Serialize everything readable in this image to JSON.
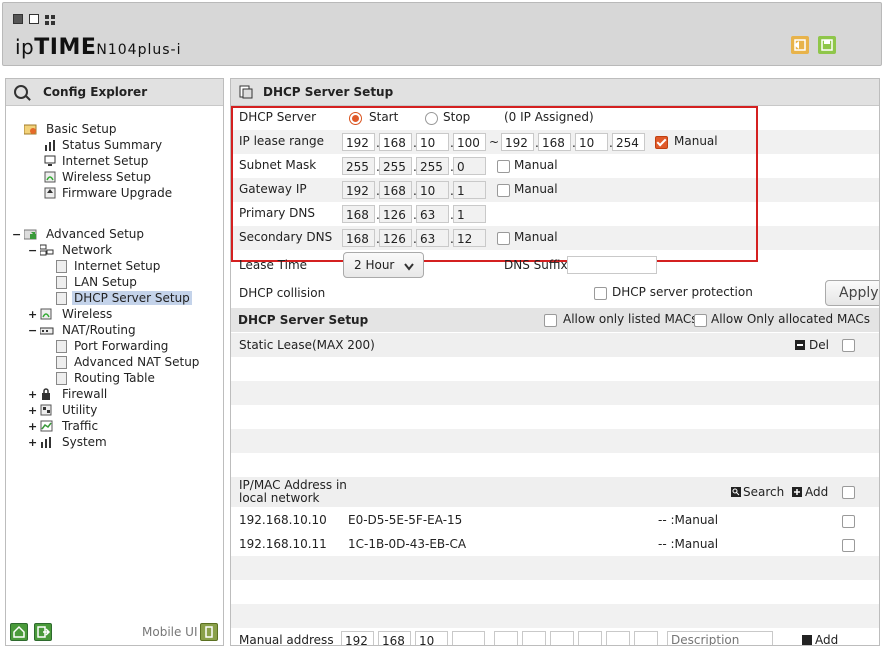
{
  "header": {
    "brand_lower": "ip",
    "brand_upper": "TIME",
    "model": "N104plus-i"
  },
  "sidebar": {
    "title": "Config Explorer",
    "basic": {
      "label": "Basic Setup",
      "items": [
        "Status Summary",
        "Internet Setup",
        "Wireless Setup",
        "Firmware Upgrade"
      ]
    },
    "advanced": {
      "label": "Advanced Setup",
      "network": {
        "label": "Network",
        "items": [
          "Internet Setup",
          "LAN Setup",
          "DHCP Server Setup"
        ]
      },
      "wireless": "Wireless",
      "nat": {
        "label": "NAT/Routing",
        "items": [
          "Port Forwarding",
          "Advanced NAT Setup",
          "Routing Table"
        ]
      },
      "firewall": "Firewall",
      "utility": "Utility",
      "traffic": "Traffic",
      "system": "System"
    },
    "mobile_label": "Mobile UI"
  },
  "main": {
    "title": "DHCP Server Setup",
    "dhcp_server": {
      "label": "DHCP Server",
      "start": "Start",
      "stop": "Stop",
      "assigned": "(0 IP Assigned)"
    },
    "lease_range": {
      "label": "IP lease range",
      "from": [
        "192",
        "168",
        "10",
        "100"
      ],
      "tilde": "~",
      "to": [
        "192",
        "168",
        "10",
        "254"
      ],
      "manual": "Manual"
    },
    "subnet": {
      "label": "Subnet Mask",
      "ip": [
        "255",
        "255",
        "255",
        "0"
      ],
      "manual": "Manual"
    },
    "gateway": {
      "label": "Gateway IP",
      "ip": [
        "192",
        "168",
        "10",
        "1"
      ],
      "manual": "Manual"
    },
    "primary_dns": {
      "label": "Primary DNS",
      "ip": [
        "168",
        "126",
        "63",
        "1"
      ]
    },
    "secondary_dns": {
      "label": "Secondary DNS",
      "ip": [
        "168",
        "126",
        "63",
        "12"
      ],
      "manual": "Manual"
    },
    "lease_time": {
      "label": "Lease Time",
      "value": "2 Hour"
    },
    "dns_suffix": {
      "label": "DNS Suffix",
      "value": ""
    },
    "collision": {
      "label": "DHCP collision",
      "protection": "DHCP server protection",
      "apply": "Apply"
    },
    "section2": {
      "title": "DHCP Server Setup",
      "allow_listed": "Allow only listed MACs",
      "allow_allocated": "Allow Only allocated MACs"
    },
    "static_lease": {
      "label": "Static Lease(MAX 200)",
      "del": "Del"
    },
    "mac_list": {
      "label_line1": "IP/MAC Address in",
      "label_line2": "local network",
      "search": "Search",
      "add": "Add",
      "rows": [
        {
          "ip": "192.168.10.10",
          "mac": "E0-D5-5E-5F-EA-15",
          "type": "-- :Manual"
        },
        {
          "ip": "192.168.10.11",
          "mac": "1C-1B-0D-43-EB-CA",
          "type": "-- :Manual"
        }
      ]
    },
    "manual_address": {
      "label": "Manual address",
      "ip": [
        "192",
        "168",
        "10"
      ],
      "description_placeholder": "Description",
      "add": "Add"
    }
  },
  "colors": {
    "accent": "#e05a2a",
    "highlight_box": "#d42020",
    "selected": "#c4d3ea"
  }
}
